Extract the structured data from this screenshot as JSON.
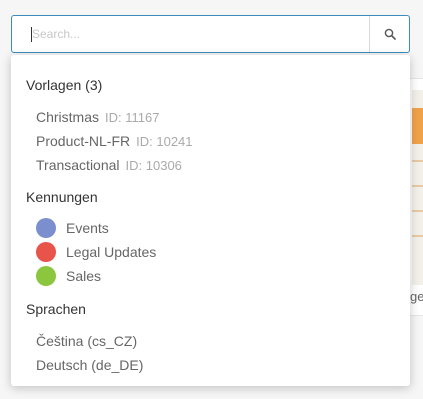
{
  "search": {
    "placeholder": "Search...",
    "value": ""
  },
  "background": {
    "partial_text": "ge"
  },
  "sections": {
    "templates": {
      "title": "Vorlagen (3)",
      "items": [
        {
          "name": "Christmas",
          "id": "ID: 11167"
        },
        {
          "name": "Product-NL-FR",
          "id": "ID: 10241"
        },
        {
          "name": "Transactional",
          "id": "ID: 10306"
        }
      ]
    },
    "tags": {
      "title": "Kennungen",
      "items": [
        {
          "name": "Events",
          "color": "#7b8fcf"
        },
        {
          "name": "Legal Updates",
          "color": "#e8534a"
        },
        {
          "name": "Sales",
          "color": "#8cc63f"
        }
      ]
    },
    "languages": {
      "title": "Sprachen",
      "items": [
        {
          "name": "Čeština (cs_CZ)"
        },
        {
          "name": "Deutsch (de_DE)"
        }
      ]
    }
  }
}
